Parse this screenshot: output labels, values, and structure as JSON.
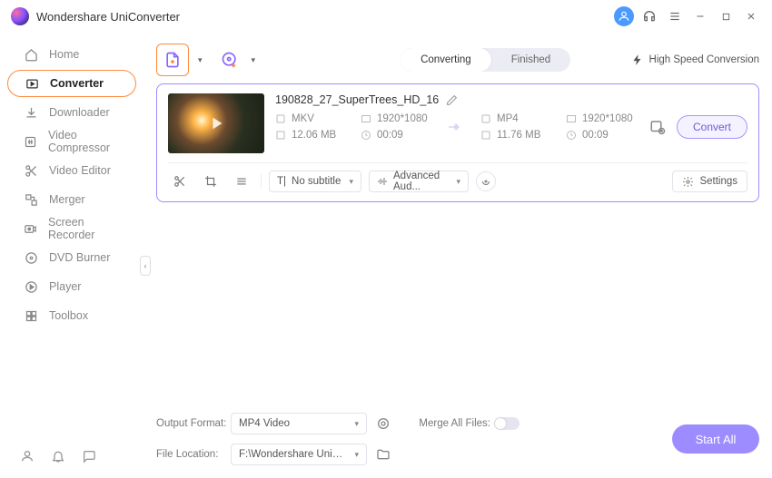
{
  "app": {
    "title": "Wondershare UniConverter"
  },
  "sidebar": {
    "items": [
      {
        "label": "Home"
      },
      {
        "label": "Converter"
      },
      {
        "label": "Downloader"
      },
      {
        "label": "Video Compressor"
      },
      {
        "label": "Video Editor"
      },
      {
        "label": "Merger"
      },
      {
        "label": "Screen Recorder"
      },
      {
        "label": "DVD Burner"
      },
      {
        "label": "Player"
      },
      {
        "label": "Toolbox"
      }
    ]
  },
  "tabs": {
    "converting": "Converting",
    "finished": "Finished"
  },
  "highspeed_label": "High Speed Conversion",
  "file": {
    "name": "190828_27_SuperTrees_HD_16",
    "src_format": "MKV",
    "src_res": "1920*1080",
    "src_size": "12.06 MB",
    "src_dur": "00:09",
    "dst_format": "MP4",
    "dst_res": "1920*1080",
    "dst_size": "11.76 MB",
    "dst_dur": "00:09",
    "convert_label": "Convert",
    "subtitle": "No subtitle",
    "audio": "Advanced Aud...",
    "settings_label": "Settings"
  },
  "footer": {
    "output_format_label": "Output Format:",
    "output_format_value": "MP4 Video",
    "file_location_label": "File Location:",
    "file_location_value": "F:\\Wondershare UniConverter",
    "merge_label": "Merge All Files:",
    "start_all": "Start All"
  }
}
